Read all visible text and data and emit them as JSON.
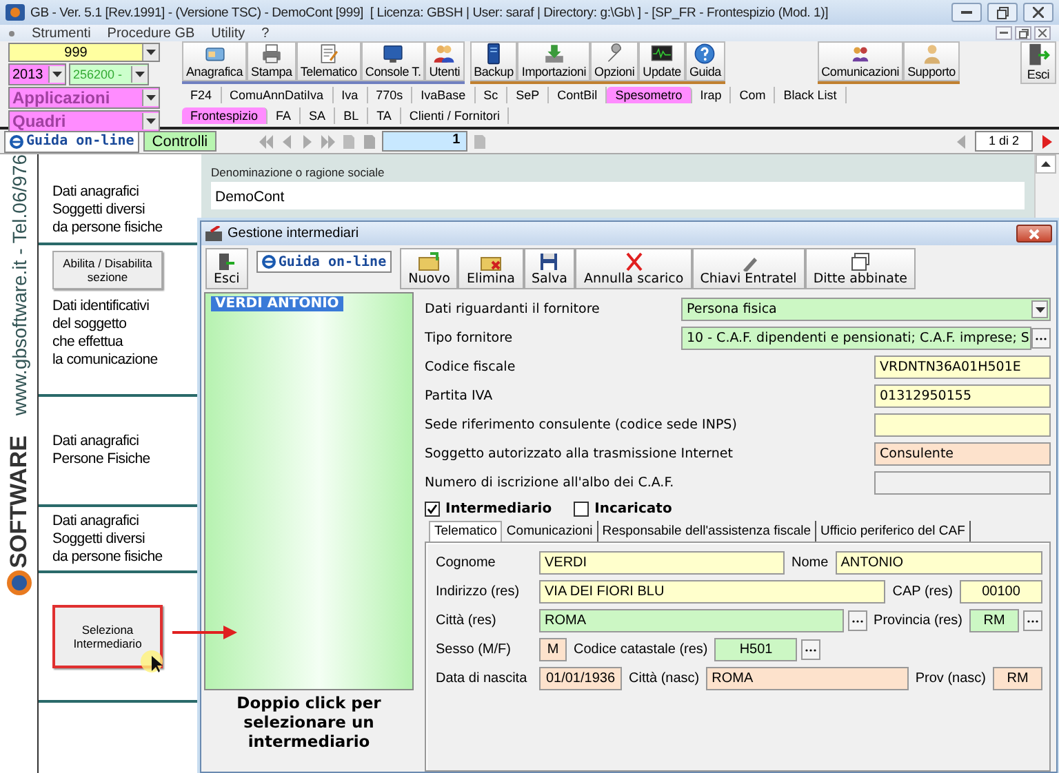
{
  "window": {
    "title": "GB - Ver. 5.1 [Rev.1991] - (Versione TSC) - DemoCont [999]  [ Licenza: GBSH | User: saraf | Directory: g:\\Gb\\ ] - [SP_FR - Frontespizio (Mod. 1)]"
  },
  "menu": [
    "Strumenti",
    "Procedure GB",
    "Utility",
    "?"
  ],
  "selectors": {
    "company": "999",
    "year": "2013",
    "code": "256200 -",
    "applications": "Applicazioni",
    "sections": "Quadri"
  },
  "toolbar_groups": [
    [
      "Anagrafica",
      "Stampa",
      "Telematico",
      "Console T.",
      "Utenti"
    ],
    [
      "Backup",
      "Importazioni",
      "Opzioni",
      "Update",
      "Guida"
    ],
    [
      "Comunicazioni",
      "Supporto"
    ]
  ],
  "exit_button": "Esci",
  "module_tabs": [
    {
      "label": "F24",
      "selected": false
    },
    {
      "label": "ComuAnnDatiIva",
      "selected": false
    },
    {
      "label": "Iva",
      "selected": false
    },
    {
      "label": "770s",
      "selected": false
    },
    {
      "label": "IvaBase",
      "selected": false
    },
    {
      "label": "Sc",
      "selected": false
    },
    {
      "label": "SeP",
      "selected": false
    },
    {
      "label": "ContBil",
      "selected": false
    },
    {
      "label": "Spesometro",
      "selected": true
    },
    {
      "label": "Irap",
      "selected": false
    },
    {
      "label": "Com",
      "selected": false
    },
    {
      "label": "Black List",
      "selected": false
    }
  ],
  "section_tabs": [
    {
      "label": "Frontespizio",
      "selected": true
    },
    {
      "label": "FA",
      "selected": false
    },
    {
      "label": "SA",
      "selected": false
    },
    {
      "label": "BL",
      "selected": false
    },
    {
      "label": "TA",
      "selected": false
    },
    {
      "label": "Clienti / Fornitori",
      "selected": false
    }
  ],
  "nav": {
    "guide_button": "Guida on-line",
    "checks_button": "Controlli",
    "page": "1",
    "page_of": "1 di 2"
  },
  "side_strip": {
    "website": "www.gbsoftware.it - Tel.06/976",
    "logo": "SOFTWARE"
  },
  "sections": [
    {
      "items": [
        {
          "kind": "heading",
          "lines": [
            "Dati anagrafici",
            "Soggetti diversi",
            "da persone fisiche"
          ]
        }
      ]
    },
    {
      "items": [
        {
          "kind": "button",
          "label": "Abilita / Disabilita sezione",
          "highlighted": false
        },
        {
          "kind": "heading",
          "lines": [
            "Dati identificativi",
            "del soggetto",
            "che effettua",
            "la comunicazione"
          ]
        }
      ]
    },
    {
      "items": [
        {
          "kind": "heading",
          "lines": [
            "Dati anagrafici",
            "Persone Fisiche"
          ]
        }
      ]
    },
    {
      "items": [
        {
          "kind": "heading",
          "lines": [
            "Dati anagrafici",
            "Soggetti diversi",
            "da persone fisiche"
          ]
        }
      ]
    },
    {
      "items": [
        {
          "kind": "button",
          "label": "Seleziona Intermediario",
          "highlighted": true
        }
      ]
    }
  ],
  "content": {
    "label": "Denominazione o ragione sociale",
    "value": "DemoCont"
  },
  "dialog": {
    "title": "Gestione intermediari",
    "exit_button": "Esci",
    "guide_button": "Guida on-line",
    "toolbar": [
      "Nuovo",
      "Elimina",
      "Salva",
      "Annulla scarico",
      "Chiavi Entratel",
      "Ditte abbinate"
    ],
    "list": [
      {
        "label": "VERDI ANTONIO",
        "selected": true
      }
    ],
    "list_hint": "Doppio click per selezionare un intermediario",
    "rows": [
      {
        "label": "Dati riguardanti il fornitore",
        "value": "Persona fisica",
        "kind": "dropdown",
        "color": "#ccf7c4"
      },
      {
        "label": "Tipo fornitore",
        "value": "10 - C.A.F. dipendenti e pensionati; C.A.F. imprese; S",
        "kind": "lookup",
        "color": "#ccf7c4"
      },
      {
        "label": "Codice fiscale",
        "value": "VRDNTN36A01H501E",
        "kind": "text",
        "color": "#ffffcc"
      },
      {
        "label": "Partita IVA",
        "value": "01312950155",
        "kind": "text",
        "color": "#ffffcc"
      },
      {
        "label": "Sede riferimento consulente (codice sede INPS)",
        "kind": "text",
        "color": "#ffffcc"
      },
      {
        "label": "Soggetto autorizzato alla trasmissione Internet",
        "value": "Consulente",
        "kind": "text",
        "color": "#fde2cc"
      },
      {
        "label": "Numero di iscrizione all'albo dei C.A.F.",
        "kind": "text",
        "color": "#f0f0f0"
      }
    ],
    "checkboxes": [
      {
        "label": "Intermediario",
        "checked": true
      },
      {
        "label": "Incaricato",
        "checked": false
      }
    ],
    "tabs": [
      {
        "label": "Telematico",
        "selected": true
      },
      {
        "label": "Comunicazioni",
        "selected": false
      },
      {
        "label": "Responsabile dell'assistenza fiscale",
        "selected": false
      },
      {
        "label": "Ufficio periferico del CAF",
        "selected": false
      }
    ],
    "tab_rows": [
      [
        {
          "label": "Cognome",
          "value": "VERDI",
          "kind": "name",
          "color": "#ffffcc",
          "lookup": false
        },
        {
          "label": "Nome",
          "value": "ANTONIO",
          "kind": "long",
          "color": "#ffffcc",
          "lookup": false
        }
      ],
      [
        {
          "label": "Indirizzo (res)",
          "value": "VIA DEI FIORI BLU",
          "kind": "long",
          "color": "#ffffcc",
          "lookup": false
        },
        {
          "label": "CAP (res)",
          "value": "00100",
          "kind": "code",
          "color": "#ffffcc",
          "lookup": false
        }
      ],
      [
        {
          "label": "Città (res)",
          "value": "ROMA",
          "kind": "long",
          "color": "#ccf7c4",
          "lookup": true
        },
        {
          "label": "Provincia (res)",
          "value": "RM",
          "kind": "short",
          "color": "#ccf7c4",
          "lookup": true
        }
      ],
      [
        {
          "label": "Sesso (M/F)",
          "value": "M",
          "kind": "char",
          "color": "#fde2cc",
          "lookup": false
        },
        {
          "label": "Codice catastale (res)",
          "value": "H501",
          "kind": "code",
          "color": "#ccf7c4",
          "lookup": true
        }
      ],
      [
        {
          "label": "Data di nascita",
          "value": "01/01/1936",
          "kind": "code",
          "color": "#fde2cc",
          "lookup": false
        },
        {
          "label": "Città (nasc)",
          "value": "ROMA",
          "kind": "long",
          "color": "#fde2cc",
          "lookup": false
        },
        {
          "label": "Prov (nasc)",
          "value": "RM",
          "kind": "short",
          "color": "#fde2cc",
          "lookup": false
        }
      ]
    ]
  }
}
